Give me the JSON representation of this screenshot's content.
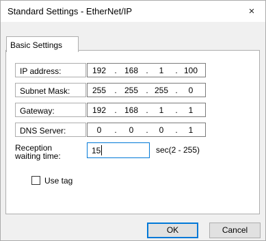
{
  "window": {
    "title": "Standard Settings - EtherNet/IP",
    "close_icon": "×"
  },
  "tabs": [
    {
      "label": "Basic Settings"
    }
  ],
  "fields": {
    "ip_address": {
      "label": "IP address:",
      "octets": [
        "192",
        "168",
        "1",
        "100"
      ]
    },
    "subnet_mask": {
      "label": "Subnet Mask:",
      "octets": [
        "255",
        "255",
        "255",
        "0"
      ]
    },
    "gateway": {
      "label": "Gateway:",
      "octets": [
        "192",
        "168",
        "1",
        "1"
      ]
    },
    "dns_server": {
      "label": "DNS Server:",
      "octets": [
        "0",
        "0",
        "0",
        "1"
      ]
    },
    "separator": ".",
    "reception": {
      "label_line1": "Reception",
      "label_line2": "waiting time:",
      "value": "15",
      "unit": "sec(2 - 255)"
    },
    "use_tag": {
      "label": "Use tag",
      "checked": false
    }
  },
  "buttons": {
    "ok": "OK",
    "cancel": "Cancel"
  },
  "colors": {
    "focus_border": "#0078d7",
    "panel_bg": "#ffffff",
    "dialog_bg": "#f0f0f0"
  }
}
